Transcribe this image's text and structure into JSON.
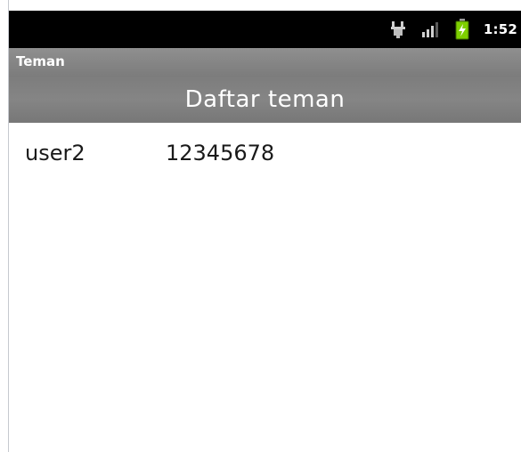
{
  "status_bar": {
    "time": "1:52",
    "icons": [
      "usb-debug-icon",
      "signal-icon",
      "battery-charging-icon"
    ]
  },
  "app": {
    "title": "Teman"
  },
  "header": {
    "title": "Daftar teman"
  },
  "friends": [
    {
      "name": "user2",
      "phone": "12345678"
    }
  ],
  "colors": {
    "status_bar_bg": "#000000",
    "title_bar_bg": "#8a8a8a",
    "header_bg": "#808080",
    "battery_green": "#7ed000"
  }
}
